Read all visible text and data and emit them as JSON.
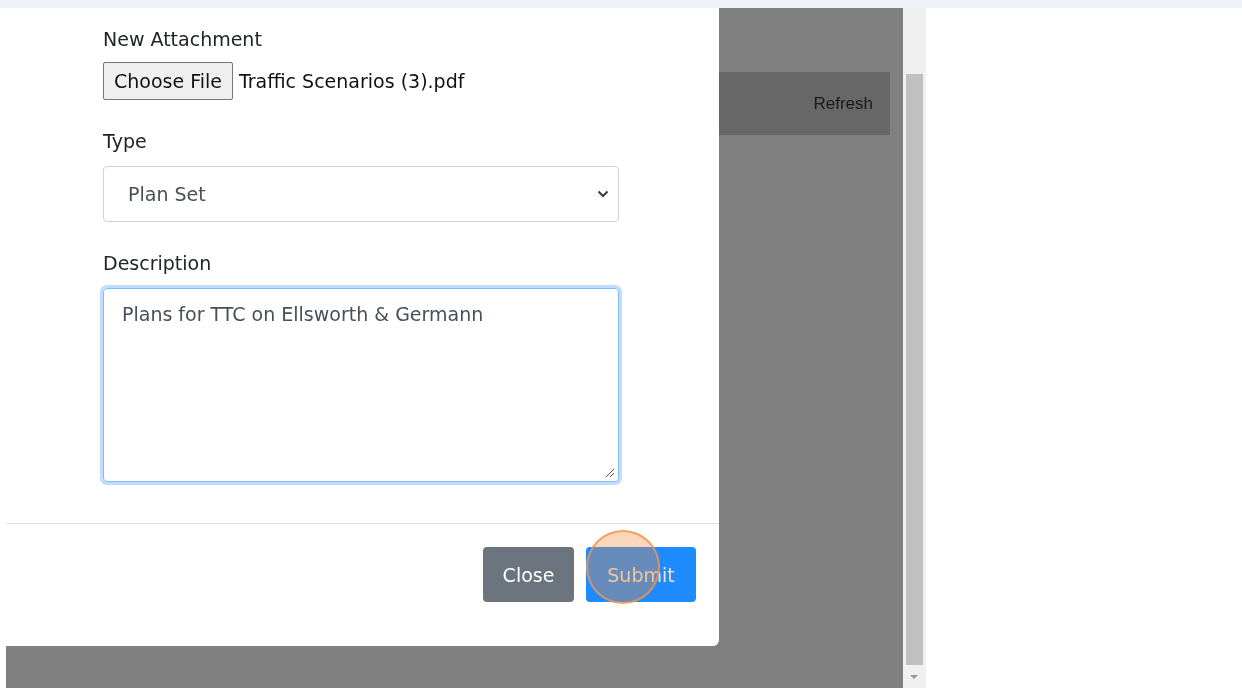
{
  "modal": {
    "attachment": {
      "label": "New Attachment",
      "button": "Choose File",
      "file_name": "Traffic Scenarios (3).pdf"
    },
    "type": {
      "label": "Type",
      "value": "Plan Set"
    },
    "description": {
      "label": "Description",
      "value": "Plans for TTC on Ellsworth & Germann",
      "focused": true
    },
    "buttons": [
      {
        "label": "Close",
        "kind": "secondary"
      },
      {
        "label": "Submit",
        "kind": "primary",
        "highlighted": true
      }
    ]
  },
  "background": {
    "refresh": "Refresh"
  }
}
